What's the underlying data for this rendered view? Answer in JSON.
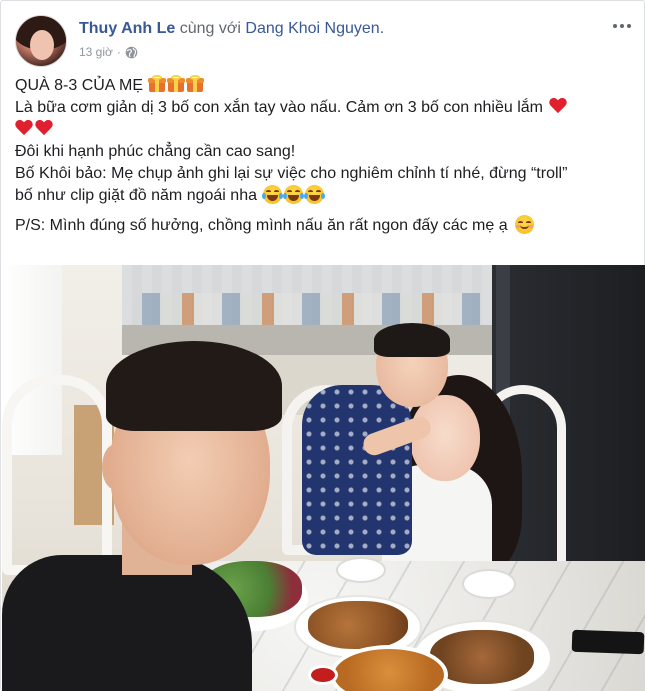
{
  "post": {
    "author": "Thuy Anh Le",
    "with_text": "cùng với",
    "tagged": "Dang Khoi Nguyen.",
    "time": "13 giờ",
    "dot": "·",
    "lines": {
      "line1": "QUÀ 8-3 CỦA MẸ",
      "line2": "Là bữa cơm giản dị 3 bố con xắn tay vào nấu. Cảm ơn 3 bố con nhiều lắm",
      "line3": "Đôi khi hạnh phúc chẳng cần cao sang!",
      "line4a": "Bố Khôi bảo: Mẹ chụp ảnh ghi lại sự việc cho nghiêm chỉnh tí nhé, đừng “troll”",
      "line4b": "bố như clip giặt đồ năm ngoái nha",
      "line5": "P/S: Mình đúng số hưởng, chồng mình nấu ăn rất ngon đấy các mẹ ạ"
    },
    "icons": {
      "privacy": "globe-icon",
      "more": "more-options-icon",
      "gift": "gift-emoji",
      "heart": "red-heart-emoji",
      "laugh": "tears-of-joy-emoji",
      "smile": "smiling-face-emoji"
    }
  },
  "colors": {
    "link": "#385898",
    "text": "#1c1e21",
    "meta": "#90949c"
  }
}
